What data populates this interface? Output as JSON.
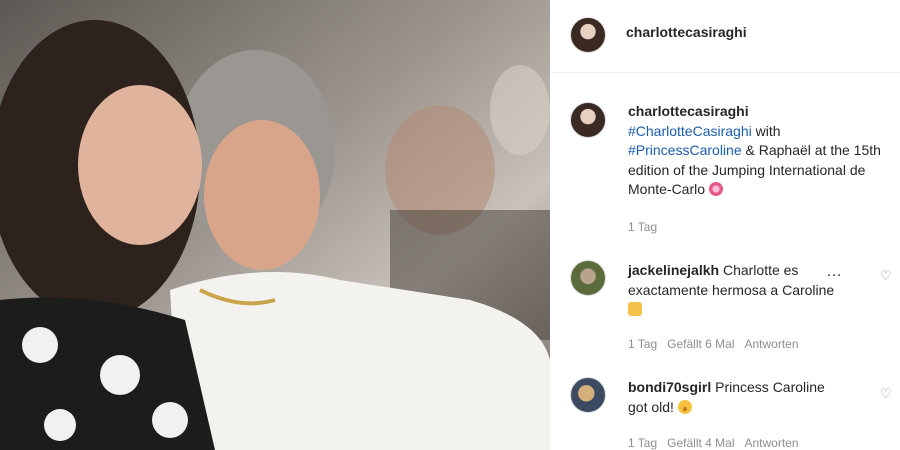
{
  "post": {
    "username": "charlottecasiraghi",
    "caption": {
      "username": "charlottecasiraghi",
      "hashtag1": "#CharlotteCasiraghi",
      "text1": " with ",
      "hashtag2": "#PrincessCaroline",
      "text2": " & Raphaël at the 15th edition of the Jumping International de Monte-Carlo ",
      "emoji": "flower-icon",
      "time": "1 Tag"
    },
    "comments": [
      {
        "username": "jackelinejalkh",
        "text": " Charlotte es exactamente hermosa a Caroline",
        "emoji": "hand-emoji-icon",
        "time": "1 Tag",
        "likes": "Gefällt 6 Mal",
        "reply": "Antworten"
      },
      {
        "username": "bondi70sgirl",
        "text": " Princess Caroline got old! ",
        "emoji": "sad-face-icon",
        "time": "1 Tag",
        "likes": "Gefällt 4 Mal",
        "reply": "Antworten"
      }
    ]
  },
  "colors": {
    "hashtag": "#1a5cad",
    "meta": "#8e8e8e",
    "text": "#262626"
  }
}
